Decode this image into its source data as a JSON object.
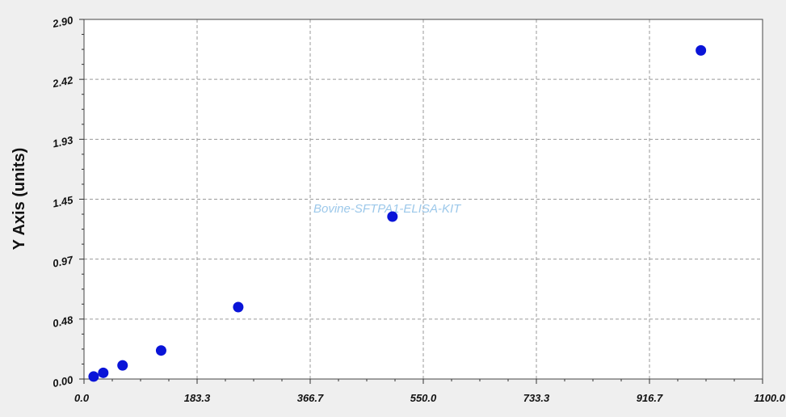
{
  "chart_data": {
    "type": "scatter",
    "title": "",
    "xlabel": "",
    "ylabel": "Y Axis (units)",
    "annotation": "Bovine-SFTPA1-ELISA-KIT",
    "xlim": [
      0,
      1100
    ],
    "ylim": [
      0,
      2.9
    ],
    "x_ticks": [
      "0.0",
      "183.3",
      "366.7",
      "550.0",
      "733.3",
      "916.7",
      "1100.0"
    ],
    "y_ticks": [
      "0.00",
      "0.48",
      "0.97",
      "1.45",
      "1.93",
      "2.42",
      "2.90"
    ],
    "grid": true,
    "point_color": "#0a14d8",
    "series": [
      {
        "x": [
          15.6,
          31.2,
          62.5,
          125,
          250,
          500,
          1000
        ],
        "y": [
          0.02,
          0.05,
          0.11,
          0.23,
          0.58,
          1.31,
          2.65
        ]
      }
    ]
  }
}
